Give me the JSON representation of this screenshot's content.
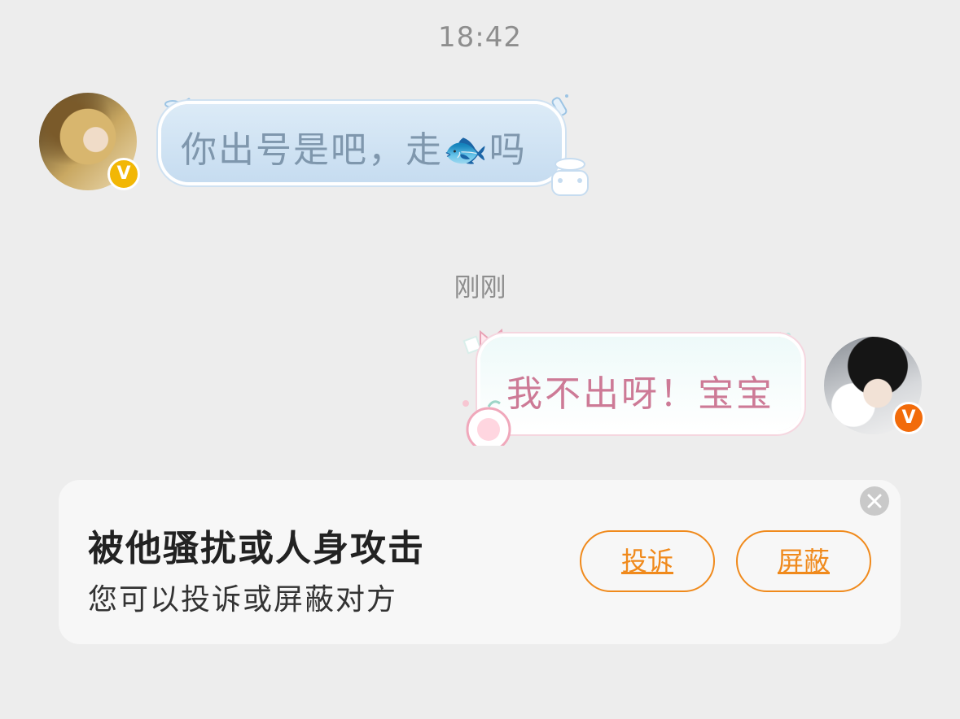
{
  "chat": {
    "timestamp_1": "18:42",
    "timestamp_2": "刚刚",
    "incoming_message": {
      "text": "你出号是吧，走",
      "emoji": "🐟",
      "text_end": "吗",
      "badge": "V"
    },
    "outgoing_message": {
      "text": "我不出呀！宝宝",
      "badge": "V"
    }
  },
  "report_panel": {
    "title": "被他骚扰或人身攻击",
    "subtitle": "您可以投诉或屏蔽对方",
    "report_label": "投诉",
    "block_label": "屏蔽"
  },
  "colors": {
    "background": "#ededed",
    "accent_orange": "#f08a1c",
    "incoming_text": "#7f97ad",
    "outgoing_text": "#cd7a96",
    "badge_gold": "#f2b705",
    "badge_orange": "#f26b0a"
  }
}
